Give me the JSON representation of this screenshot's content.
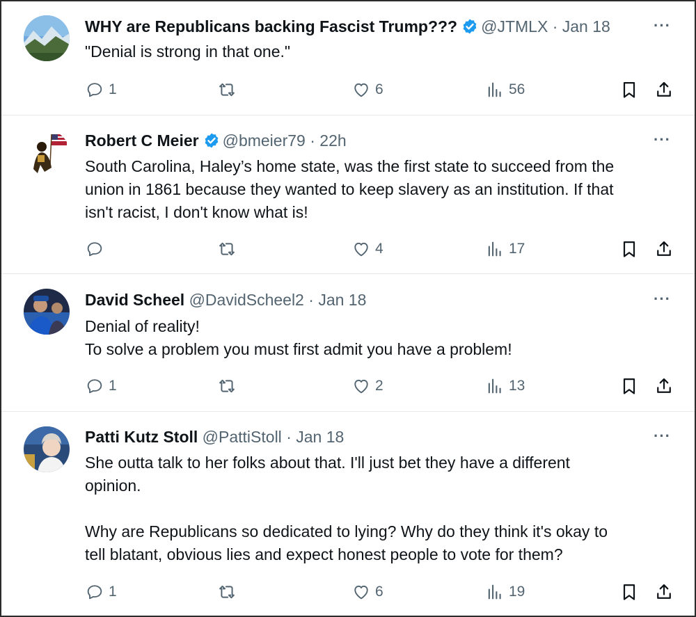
{
  "tweets": [
    {
      "name": "WHY are Republicans backing Fascist Trump???",
      "verified": true,
      "handle": "@JTMLX",
      "sep": "·",
      "time": "Jan 18",
      "more": "···",
      "lines": [
        "\"Denial is strong in that one.\""
      ],
      "replies": "1",
      "reposts": "",
      "likes": "6",
      "views": "56"
    },
    {
      "name": "Robert C Meier",
      "verified": true,
      "handle": "@bmeier79",
      "sep": "·",
      "time": "22h",
      "more": "···",
      "lines": [
        "South Carolina, Haley’s home state, was the first state to succeed from the",
        "union in 1861 because they wanted to keep slavery as an institution. If that",
        "isn't racist, I don't know what is!"
      ],
      "replies": "",
      "reposts": "",
      "likes": "4",
      "views": "17"
    },
    {
      "name": "David Scheel",
      "verified": false,
      "handle": "@DavidScheel2",
      "sep": "·",
      "time": "Jan 18",
      "more": "···",
      "lines": [
        "Denial of reality!",
        "To solve a problem you must first admit you have a problem!"
      ],
      "replies": "1",
      "reposts": "",
      "likes": "2",
      "views": "13"
    },
    {
      "name": "Patti Kutz Stoll",
      "verified": false,
      "handle": "@PattiStoll",
      "sep": "·",
      "time": "Jan 18",
      "more": "···",
      "lines": [
        "She outta talk to her folks about that. I'll just bet they have a different",
        "opinion.",
        "",
        "Why are Republicans so dedicated to lying? Why do they think it's okay to",
        "tell blatant, obvious lies and expect honest people to vote for them?"
      ],
      "replies": "1",
      "reposts": "",
      "likes": "6",
      "views": "19"
    }
  ],
  "colors": {
    "verified": "#1d9bf0",
    "text": "#0f1419",
    "muted": "#536471",
    "divider": "#e6e9eb"
  },
  "icons": [
    "reply-icon",
    "repost-icon",
    "like-icon",
    "views-icon",
    "bookmark-icon",
    "share-icon",
    "verified-badge-icon",
    "more-icon"
  ]
}
